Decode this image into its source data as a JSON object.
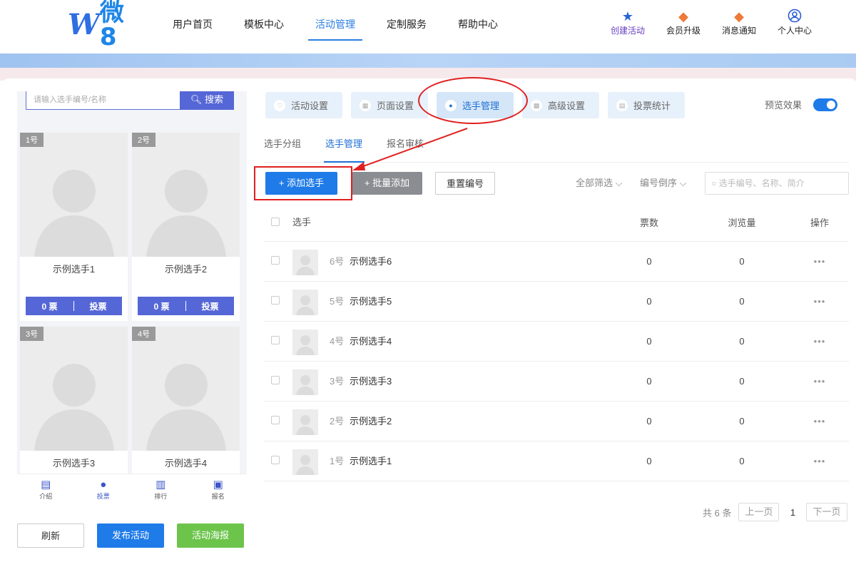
{
  "nav": {
    "logo_text": "微8",
    "items": [
      "用户首页",
      "模板中心",
      "活动管理",
      "定制服务",
      "帮助中心"
    ],
    "active_index": 2
  },
  "tools": [
    {
      "label": "创建活动",
      "icon": "star-icon"
    },
    {
      "label": "会员升级",
      "icon": "diamond-icon"
    },
    {
      "label": "消息通知",
      "icon": "bell-icon"
    },
    {
      "label": "个人中心",
      "icon": "user-icon"
    }
  ],
  "preview": {
    "search_placeholder": "请输入选手编号/名称",
    "search_button": "搜索",
    "cards": [
      {
        "badge": "1号",
        "name": "示例选手1",
        "votes": "0 票",
        "vote_btn": "投票"
      },
      {
        "badge": "2号",
        "name": "示例选手2",
        "votes": "0 票",
        "vote_btn": "投票"
      },
      {
        "badge": "3号",
        "name": "示例选手3"
      },
      {
        "badge": "4号",
        "name": "示例选手4"
      }
    ],
    "tabs": [
      "介绍",
      "投票",
      "排行",
      "报名"
    ],
    "active_tab": 1
  },
  "bottom_buttons": {
    "refresh": "刷新",
    "publish": "发布活动",
    "poster": "活动海报"
  },
  "content_tabs": [
    "活动设置",
    "页面设置",
    "选手管理",
    "高级设置",
    "投票统计"
  ],
  "active_content_tab": 2,
  "preview_effect_label": "预览效果",
  "sub_tabs": [
    "选手分组",
    "选手管理",
    "报名审核"
  ],
  "active_sub_tab": 1,
  "toolbar": {
    "add": "+ 添加选手",
    "batch": "+ 批量添加",
    "reset": "重置编号",
    "filter_all": "全部筛选",
    "filter_order": "编号倒序",
    "search_placeholder": "选手编号、名称、简介"
  },
  "table": {
    "headers": {
      "player": "选手",
      "votes": "票数",
      "views": "浏览量",
      "ops": "操作"
    },
    "rows": [
      {
        "num": "6号",
        "name": "示例选手6",
        "votes": "0",
        "views": "0"
      },
      {
        "num": "5号",
        "name": "示例选手5",
        "votes": "0",
        "views": "0"
      },
      {
        "num": "4号",
        "name": "示例选手4",
        "votes": "0",
        "views": "0"
      },
      {
        "num": "3号",
        "name": "示例选手3",
        "votes": "0",
        "views": "0"
      },
      {
        "num": "2号",
        "name": "示例选手2",
        "votes": "0",
        "views": "0"
      },
      {
        "num": "1号",
        "name": "示例选手1",
        "votes": "0",
        "views": "0"
      }
    ],
    "ops_symbol": "•••"
  },
  "pager": {
    "total": "共 6 条",
    "prev": "上一页",
    "current": "1",
    "next": "下一页"
  },
  "colors": {
    "primary": "#1e7be8",
    "preview_accent": "#5566d6",
    "annotation": "#e02020"
  }
}
